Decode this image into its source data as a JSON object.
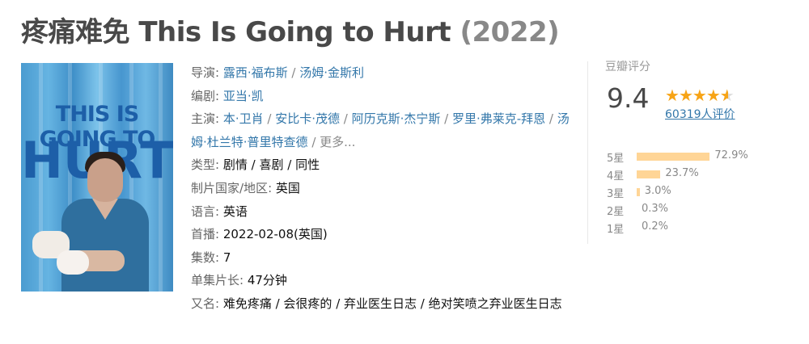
{
  "title": {
    "main": "疼痛难免 This Is Going to Hurt",
    "year": "(2022)"
  },
  "poster": {
    "line1": "THIS IS GOING TO",
    "line2": "HURT"
  },
  "info": {
    "director": {
      "label": "导演",
      "names": [
        "露西·福布斯",
        "汤姆·金斯利"
      ]
    },
    "writer": {
      "label": "编剧",
      "names": [
        "亚当·凯"
      ]
    },
    "cast": {
      "label": "主演",
      "names": [
        "本·卫肖",
        "安比卡·茂德",
        "阿历克斯·杰宁斯",
        "罗里·弗莱克-拜恩",
        "汤姆·杜兰特·普里特查德"
      ],
      "more": "更多..."
    },
    "genre": {
      "label": "类型",
      "values": [
        "剧情",
        "喜剧",
        "同性"
      ]
    },
    "region": {
      "label": "制片国家/地区",
      "value": "英国"
    },
    "language": {
      "label": "语言",
      "value": "英语"
    },
    "premiere": {
      "label": "首播",
      "value": "2022-02-08(英国)"
    },
    "episodes": {
      "label": "集数",
      "value": "7"
    },
    "runtime": {
      "label": "单集片长",
      "value": "47分钟"
    },
    "aka": {
      "label": "又名",
      "value": "难免疼痛 / 会很疼的 / 弃业医生日志 / 绝对笑喷之弃业医生日志"
    }
  },
  "rating": {
    "label": "豆瓣评分",
    "score": "9.4",
    "stars": 4.5,
    "votes": "60319人评价",
    "distribution": [
      {
        "label": "5星",
        "percent": 72.9,
        "text": "72.9%"
      },
      {
        "label": "4星",
        "percent": 23.7,
        "text": "23.7%"
      },
      {
        "label": "3星",
        "percent": 3.0,
        "text": "3.0%"
      },
      {
        "label": "2星",
        "percent": 0.3,
        "text": "0.3%"
      },
      {
        "label": "1星",
        "percent": 0.2,
        "text": "0.2%"
      }
    ]
  },
  "colors": {
    "link": "#3377aa",
    "star": "#f7a416",
    "bar": "#ffd596",
    "title": "#494949"
  }
}
